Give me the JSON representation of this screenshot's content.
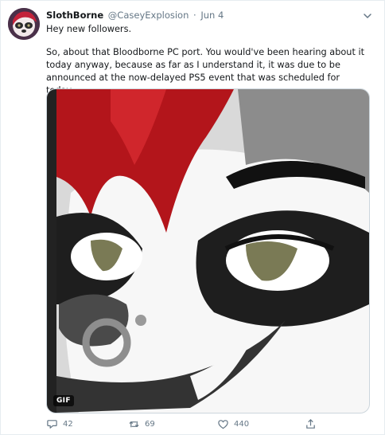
{
  "tweet": {
    "display_name": "SlothBorne",
    "handle": "@CaseyExplosion",
    "separator": "·",
    "date": "Jun 4",
    "line1": "Hey new followers.",
    "line2": "So, about that Bloodborne PC port. You would've been hearing about it today anyway, because as far as I understand it, it was due to be announced at the now-delayed PS5 event that was scheduled for today.",
    "media_badge": "GIF"
  },
  "actions": {
    "replies": "42",
    "retweets": "69",
    "likes": "440"
  },
  "icons": {
    "avatar": "avatar",
    "chevron": "chevron-down-icon",
    "reply": "reply-icon",
    "retweet": "retweet-icon",
    "like": "heart-icon",
    "share": "share-icon"
  },
  "colors": {
    "text": "#14171a",
    "muted": "#657786",
    "border": "#e6ecf0"
  }
}
